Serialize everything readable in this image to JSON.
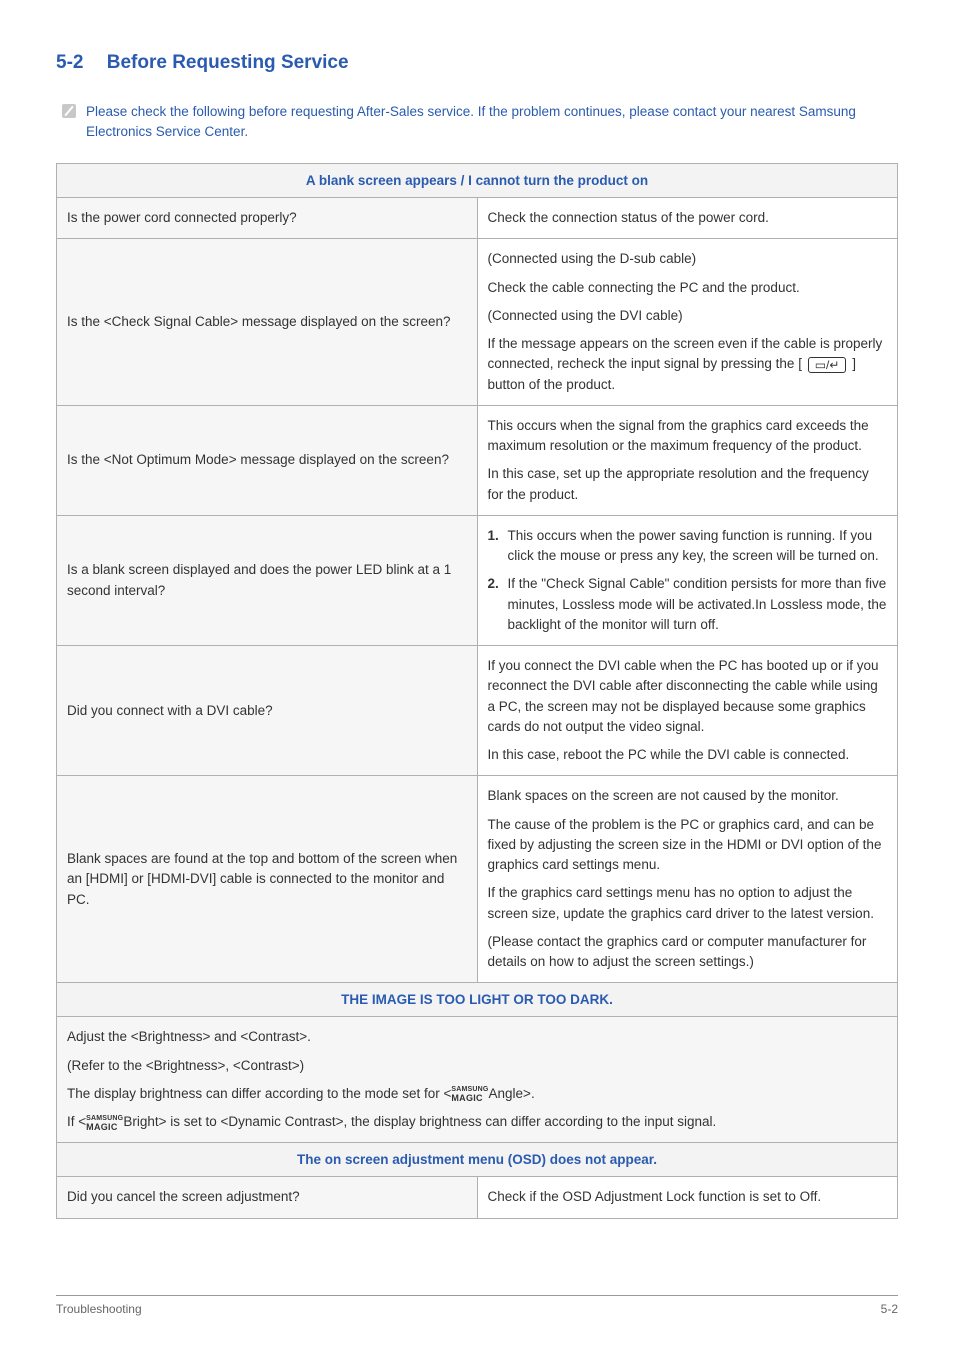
{
  "title": {
    "num": "5-2",
    "text": "Before Requesting Service"
  },
  "note": "Please check the following before requesting After-Sales service. If the problem continues, please contact your nearest Samsung Electronics Service Center.",
  "sections": {
    "s1": {
      "header": "A blank screen appears / I cannot turn the product on",
      "r1": {
        "q": "Is the power cord connected properly?",
        "a": "Check the connection status of the power cord."
      },
      "r2": {
        "q": "Is the <Check Signal Cable> message displayed on the screen?",
        "a1": "(Connected using the D-sub cable)",
        "a2": "Check the cable connecting the PC and the product.",
        "a3": "(Connected using the DVI cable)",
        "a4a": "If the message appears on the screen even if the cable is properly connected, recheck the input signal by pressing the [",
        "a4b": " ] button of the product."
      },
      "r3": {
        "q": "Is the <Not Optimum Mode> message displayed on the screen?",
        "a1": "This occurs when the signal from the graphics card exceeds the maximum resolution or the maximum frequency of the product.",
        "a2": "In this case, set up the appropriate resolution and the frequency for the product."
      },
      "r4": {
        "q": "Is a blank screen displayed and does the power LED blink at a 1 second interval?",
        "n1": "1.",
        "a1": "This occurs when the power saving function is running. If you click the mouse or press any key, the screen will be turned on.",
        "n2": "2.",
        "a2": "If the \"Check Signal Cable\" condition persists for more than five minutes, Lossless mode will be activated.In Lossless mode, the backlight of the monitor will turn off."
      },
      "r5": {
        "q": "Did you connect with a DVI cable?",
        "a1": "If you connect the DVI cable when the PC has booted up or if you reconnect the DVI cable after disconnecting the cable while using a PC, the screen may not be displayed because some graphics cards do not output the video signal.",
        "a2": "In this case, reboot the PC while the DVI cable is connected."
      },
      "r6": {
        "q": "Blank spaces are found at the top and bottom of the screen when an [HDMI] or [HDMI-DVI] cable is connected to the monitor and PC.",
        "a1": "Blank spaces on the screen are not caused by the monitor.",
        "a2": "The cause of the problem is the PC or graphics card, and can be fixed by adjusting the screen size in the HDMI or DVI option of the graphics card settings menu.",
        "a3": "If the graphics card settings menu has no option to adjust the screen size, update the graphics card driver to the latest version.",
        "a4": "(Please contact the graphics card or computer manufacturer for details on how to adjust the screen settings.)"
      }
    },
    "s2": {
      "header": "THE IMAGE IS TOO LIGHT OR TOO DARK.",
      "l1": "Adjust the <Brightness> and <Contrast>.",
      "l2": "(Refer to the <Brightness>, <Contrast>)",
      "l3a": "The display brightness can differ according to the mode set for <",
      "l3b": "Angle>.",
      "l4a": "If <",
      "l4b": "Bright> is set to <Dynamic Contrast>, the display brightness can differ according to the input signal."
    },
    "s3": {
      "header": "The on screen adjustment menu (OSD) does not appear.",
      "q": "Did you cancel the screen adjustment?",
      "a": "Check if the OSD Adjustment Lock function is set to Off."
    }
  },
  "magic": {
    "top": "SAMSUNG",
    "bottom": "MAGIC"
  },
  "button_glyph": "▭/↵",
  "footer": {
    "left": "Troubleshooting",
    "right": "5-2"
  }
}
